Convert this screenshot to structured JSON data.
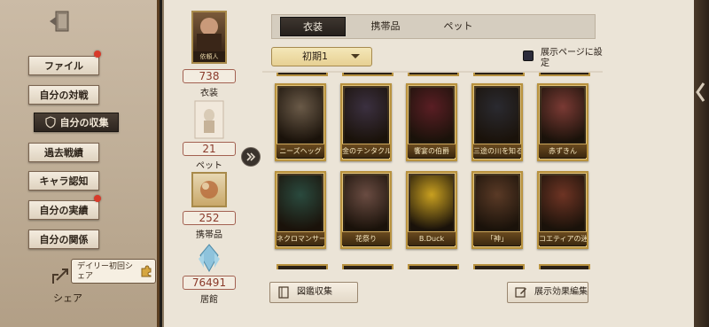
{
  "sidebar": {
    "menu": [
      {
        "label": "ファイル",
        "badge": true,
        "active": false
      },
      {
        "label": "自分の対戦",
        "badge": false,
        "active": false
      },
      {
        "label": "自分の収集",
        "badge": false,
        "active": true
      },
      {
        "label": "過去戦績",
        "badge": false,
        "active": false
      },
      {
        "label": "キャラ認知",
        "badge": false,
        "active": false
      },
      {
        "label": "自分の実績",
        "badge": true,
        "active": false
      },
      {
        "label": "自分の関係",
        "badge": false,
        "active": false
      }
    ],
    "share_bubble": "デイリー初回シェア",
    "share_label": "シェア"
  },
  "stats": {
    "costume_value": "738",
    "costume_label": "衣装",
    "pet_value": "21",
    "pet_label": "ペット",
    "accessory_value": "252",
    "accessory_label": "携帯品",
    "residence_value": "76491",
    "residence_label": "居館",
    "portrait_caption": "依頼人"
  },
  "tabs": [
    "衣装",
    "携帯品",
    "ペット"
  ],
  "active_tab": 0,
  "filter": {
    "selected": "初期1"
  },
  "display_setting_label": "展示ページに設定",
  "cards": [
    {
      "name": "ニーズヘッグ",
      "color": "#6a5a48"
    },
    {
      "name": "金のテンタクル",
      "color": "#3b3040"
    },
    {
      "name": "饗宴の伯爵",
      "color": "#5a1e24"
    },
    {
      "name": "三途の川を知る者",
      "color": "#2a2a30"
    },
    {
      "name": "赤ずきん",
      "color": "#7a3a34"
    },
    {
      "name": "ネクロマンサー",
      "color": "#2a4a3e"
    },
    {
      "name": "花祭り",
      "color": "#6a4c42"
    },
    {
      "name": "B.Duck",
      "color": "#c9a020"
    },
    {
      "name": "「神」",
      "color": "#5a3a26"
    },
    {
      "name": "コエティアの迷宮",
      "color": "#6e3424"
    }
  ],
  "bottom": {
    "collection_button": "図鑑収集",
    "edit_button": "展示効果編集"
  },
  "colors": {
    "accent_gold": "#b8923f",
    "badge_red": "#d83a2a",
    "stat_red": "#8a3a2a"
  }
}
